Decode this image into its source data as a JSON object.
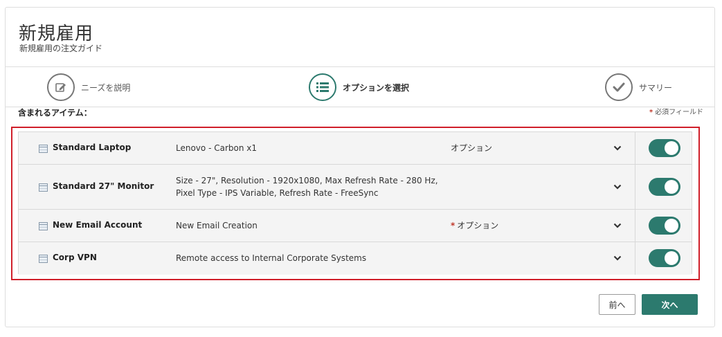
{
  "header": {
    "title": "新規雇用",
    "subtitle": "新規雇用の注文ガイド"
  },
  "steps": [
    {
      "label": "ニーズを説明",
      "icon": "edit-icon",
      "active": false
    },
    {
      "label": "オプションを選択",
      "icon": "list-icon",
      "active": true
    },
    {
      "label": "サマリー",
      "icon": "checkmark-icon",
      "active": false
    }
  ],
  "items_section": {
    "label": "含まれるアイテム：",
    "required_note": "必須フィールド",
    "required_star": "*"
  },
  "items": [
    {
      "name": "Standard Laptop",
      "description": "Lenovo - Carbon x1",
      "option": "オプション",
      "option_required": false,
      "enabled": true
    },
    {
      "name": "Standard 27\" Monitor",
      "description": "Size - 27\", Resolution - 1920x1080, Max Refresh Rate - 280 Hz, Pixel Type - IPS Variable, Refresh Rate - FreeSync",
      "option": "",
      "option_required": false,
      "enabled": true
    },
    {
      "name": "New Email Account",
      "description": "New Email Creation",
      "option": "オプション",
      "option_required": true,
      "enabled": true
    },
    {
      "name": "Corp VPN",
      "description": "Remote access to Internal Corporate Systems",
      "option": "",
      "option_required": false,
      "enabled": true
    }
  ],
  "buttons": {
    "prev": "前へ",
    "next": "次へ"
  },
  "colors": {
    "accent": "#2c7a6e",
    "highlight_border": "#d01f2a",
    "required": "#c0392b"
  }
}
